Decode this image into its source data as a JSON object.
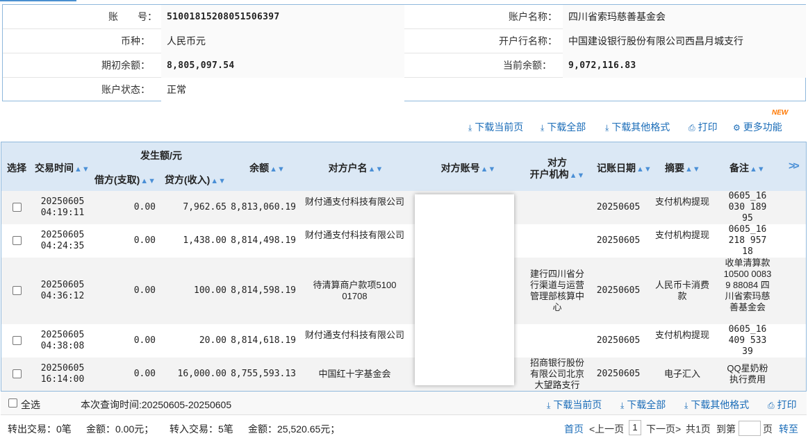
{
  "account": {
    "account_no_label": "账　　号：",
    "account_no": "51001815208051506397",
    "account_name_label": "账户名称：",
    "account_name": "四川省索玛慈善基金会",
    "currency_label": "币种：",
    "currency": "人民币元",
    "bank_label": "开户行名称：",
    "bank": "中国建设银行股份有限公司西昌月城支行",
    "opening_balance_label": "期初余额：",
    "opening_balance": "8,805,097.54",
    "current_balance_label": "当前余额：",
    "current_balance": "9,072,116.83",
    "status_label": "账户状态：",
    "status": "正常"
  },
  "toolbar": {
    "download_page": "下载当前页",
    "download_all": "下载全部",
    "download_other": "下载其他格式",
    "print": "打印",
    "more": "更多功能",
    "new_badge": "NEW"
  },
  "table": {
    "headers": {
      "select": "选择",
      "time": "交易时间",
      "amount_group": "发生额/元",
      "debit": "借方(支取)",
      "credit": "贷方(收入)",
      "balance": "余额",
      "counter_name": "对方户名",
      "counter_account": "对方账号",
      "counter_bank_1": "对方",
      "counter_bank_2": "开户机构",
      "post_date": "记账日期",
      "summary": "摘要",
      "remark": "备注",
      "more": ">>"
    },
    "rows": [
      {
        "date": "20250605",
        "time": "04:19:11",
        "debit": "0.00",
        "credit": "7,962.65",
        "balance": "8,813,060.19",
        "counter_name": "财付通支付科技有限公司",
        "counter_bank": "",
        "post_date": "20250605",
        "summary": "支付机构提现",
        "remark": "0605_16030 18995"
      },
      {
        "date": "20250605",
        "time": "04:24:35",
        "debit": "0.00",
        "credit": "1,438.00",
        "balance": "8,814,498.19",
        "counter_name": "财付通支付科技有限公司",
        "counter_bank": "",
        "post_date": "20250605",
        "summary": "支付机构提现",
        "remark": "0605_16218 95718"
      },
      {
        "date": "20250605",
        "time": "04:36:12",
        "debit": "0.00",
        "credit": "100.00",
        "balance": "8,814,598.19",
        "counter_name": "待清算商户款项510001708",
        "counter_bank": "建行四川省分行渠道与运营管理部核算中心",
        "post_date": "20250605",
        "summary": "人民币卡消费款",
        "remark": "收单清算款10500 00839 88084 四川省索玛慈善基金会"
      },
      {
        "date": "20250605",
        "time": "04:38:08",
        "debit": "0.00",
        "credit": "20.00",
        "balance": "8,814,618.19",
        "counter_name": "财付通支付科技有限公司",
        "counter_bank": "",
        "post_date": "20250605",
        "summary": "支付机构提现",
        "remark": "0605_16409 53339"
      },
      {
        "date": "20250605",
        "time": "16:14:00",
        "debit": "0.00",
        "credit": "16,000.00",
        "balance": "8,755,593.13",
        "counter_name": "中国红十字基金会",
        "counter_bank": "招商银行股份有限公司北京大望路支行",
        "post_date": "20250605",
        "summary": "电子汇入",
        "remark": "QQ星奶粉执行费用"
      }
    ]
  },
  "footer": {
    "select_all": "全选",
    "query_time": "本次查询时间:20250605-20250605",
    "download_page": "下载当前页",
    "download_all": "下载全部",
    "download_other": "下载其他格式",
    "print": "打印"
  },
  "summary": {
    "out_tx": "转出交易：0笔",
    "out_amount": "金额：0.00元；",
    "in_tx": "转入交易：5笔",
    "in_amount": "金额：25,520.65元；"
  },
  "pager": {
    "first": "首页",
    "prev": "<上一页",
    "current": "1",
    "next": "下一页>",
    "total": "共1页",
    "goto": "到第",
    "page_unit": "页",
    "go": "转至"
  }
}
